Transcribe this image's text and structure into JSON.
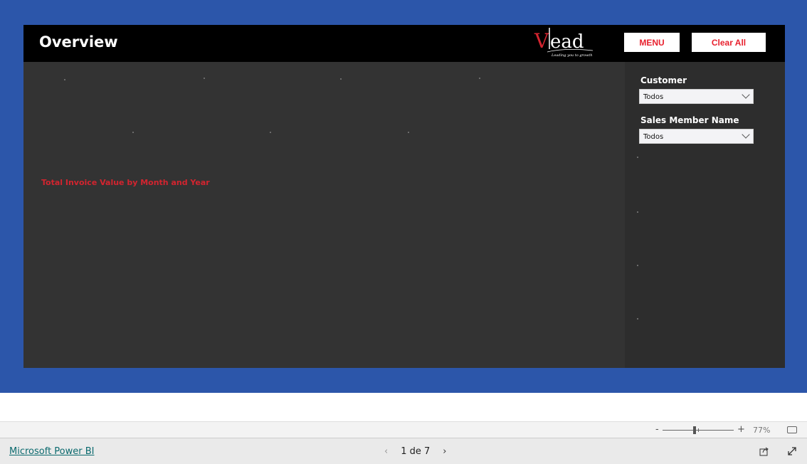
{
  "report": {
    "title": "Overview",
    "logo_text": "Vlead",
    "logo_tagline": "Leading you to growth",
    "menu_label": "MENU",
    "clear_label": "Clear All",
    "chart_title": "Total Invoice Value by Month and Year",
    "slicers": [
      {
        "label": "Customer",
        "value": "Todos"
      },
      {
        "label": "Sales Member Name",
        "value": "Todos"
      }
    ],
    "colors": {
      "accent": "#e8212e",
      "background": "#2c56aa",
      "panel": "#333333"
    }
  },
  "zoom": {
    "minus": "-",
    "plus": "+",
    "level": "77%",
    "level_fraction": 0.45
  },
  "footer": {
    "brand_link": "Microsoft Power BI",
    "page_indicator": "1 de 7",
    "prev": "‹",
    "next": "›"
  }
}
